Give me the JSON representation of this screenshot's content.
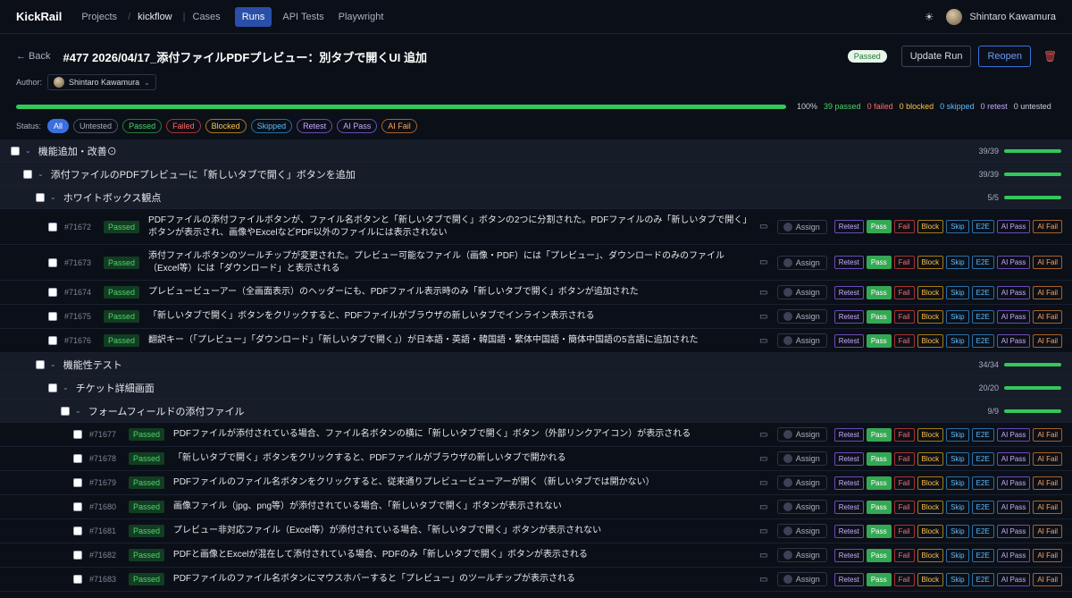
{
  "nav": {
    "brand": "KickRail",
    "projects": "Projects",
    "project_name": "kickflow",
    "cases": "Cases",
    "runs": "Runs",
    "api_tests": "API Tests",
    "playwright": "Playwright",
    "theme_icon": "sun-icon",
    "user_name": "Shintaro Kawamura"
  },
  "header": {
    "back": "← Back",
    "title": "#477 2026/04/17_添付ファイルPDFプレビュー：別タブで開くUI 追加",
    "status_pill": "Passed",
    "update_run": "Update Run",
    "reopen": "Reopen",
    "author_label": "Author:",
    "author_name": "Shintaro Kawamura"
  },
  "progress": {
    "percent_value": 1.0,
    "percent_label": "100%",
    "passed": "39 passed",
    "failed": "0 failed",
    "blocked": "0 blocked",
    "skipped": "0 skipped",
    "retest": "0 retest",
    "untested": "0 untested"
  },
  "status_filter": {
    "label": "Status:",
    "chips": [
      "All",
      "Untested",
      "Passed",
      "Failed",
      "Blocked",
      "Skipped",
      "Retest",
      "AI Pass",
      "AI Fail"
    ]
  },
  "actions": {
    "assign": "Assign",
    "retest": "Retest",
    "pass": "Pass",
    "fail": "Fail",
    "block": "Block",
    "skip": "Skip",
    "e2e": "E2E",
    "ai_pass": "AI Pass",
    "ai_fail": "AI Fail"
  },
  "groups": [
    {
      "title": "機能追加・改善⊙",
      "count": "39/39"
    },
    {
      "title": "添付ファイルのPDFプレビューに「新しいタブで開く」ボタンを追加",
      "count": "39/39"
    },
    {
      "title": "ホワイトボックス観点",
      "count": "5/5"
    },
    {
      "title": "機能性テスト",
      "count": "34/34"
    },
    {
      "title": "チケット詳細画面",
      "count": "20/20"
    },
    {
      "title": "フォームフィールドの添付ファイル",
      "count": "9/9"
    }
  ],
  "cases_a": [
    {
      "id": "#71672",
      "status": "Passed",
      "text": "PDFファイルの添付ファイルボタンが、ファイル名ボタンと「新しいタブで開く」ボタンの2つに分割された。PDFファイルのみ「新しいタブで開く」ボタンが表示され、画像やExcelなどPDF以外のファイルには表示されない"
    },
    {
      "id": "#71673",
      "status": "Passed",
      "text": "添付ファイルボタンのツールチップが変更された。プレビュー可能なファイル（画像・PDF）には「プレビュー」、ダウンロードのみのファイル（Excel等）には「ダウンロード」と表示される"
    },
    {
      "id": "#71674",
      "status": "Passed",
      "text": "プレビュービューアー（全画面表示）のヘッダーにも、PDFファイル表示時のみ「新しいタブで開く」ボタンが追加された"
    },
    {
      "id": "#71675",
      "status": "Passed",
      "text": "「新しいタブで開く」ボタンをクリックすると、PDFファイルがブラウザの新しいタブでインライン表示される"
    },
    {
      "id": "#71676",
      "status": "Passed",
      "text": "翻訳キー（「プレビュー」「ダウンロード」「新しいタブで開く」）が日本語・英語・韓国語・繁体中国語・簡体中国語の5言語に追加された"
    }
  ],
  "cases_b": [
    {
      "id": "#71677",
      "status": "Passed",
      "text": "PDFファイルが添付されている場合、ファイル名ボタンの横に「新しいタブで開く」ボタン（外部リンクアイコン）が表示される"
    },
    {
      "id": "#71678",
      "status": "Passed",
      "text": "「新しいタブで開く」ボタンをクリックすると、PDFファイルがブラウザの新しいタブで開かれる"
    },
    {
      "id": "#71679",
      "status": "Passed",
      "text": "PDFファイルのファイル名ボタンをクリックすると、従来通りプレビュービューアーが開く（新しいタブでは開かない）"
    },
    {
      "id": "#71680",
      "status": "Passed",
      "text": "画像ファイル（jpg、png等）が添付されている場合、「新しいタブで開く」ボタンが表示されない"
    },
    {
      "id": "#71681",
      "status": "Passed",
      "text": "プレビュー非対応ファイル（Excel等）が添付されている場合、「新しいタブで開く」ボタンが表示されない"
    },
    {
      "id": "#71682",
      "status": "Passed",
      "text": "PDFと画像とExcelが混在して添付されている場合、PDFのみ「新しいタブで開く」ボタンが表示される"
    },
    {
      "id": "#71683",
      "status": "Passed",
      "text": "PDFファイルのファイル名ボタンにマウスホバーすると「プレビュー」のツールチップが表示される"
    }
  ]
}
